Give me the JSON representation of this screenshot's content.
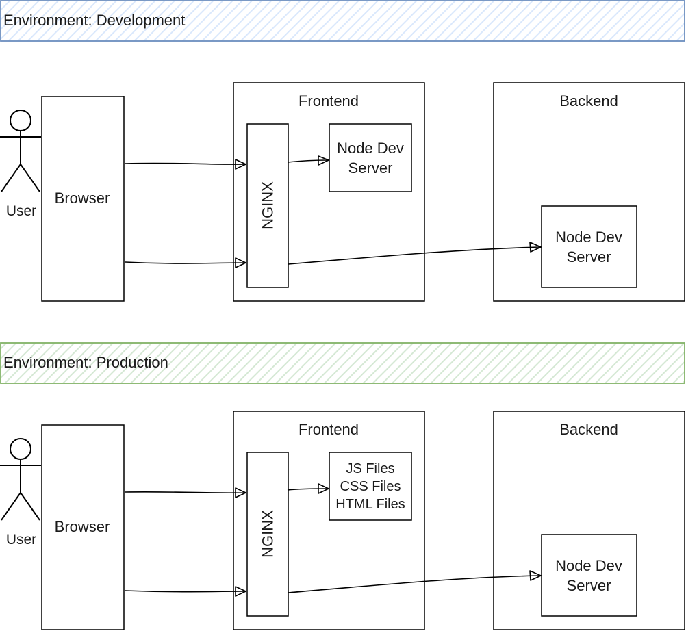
{
  "environments": [
    {
      "title": "Environment: Development",
      "color": "#6c8ebf",
      "hatch": "#dae8fc",
      "user_label": "User",
      "browser_label": "Browser",
      "frontend_label": "Frontend",
      "nginx_label": "NGINX",
      "frontend_target_lines": [
        "Node Dev",
        "Server"
      ],
      "backend_label": "Backend",
      "backend_server_lines": [
        "Node Dev",
        "Server"
      ]
    },
    {
      "title": "Environment: Production",
      "color": "#82b366",
      "hatch": "#d5e8d4",
      "user_label": "User",
      "browser_label": "Browser",
      "frontend_label": "Frontend",
      "nginx_label": "NGINX",
      "frontend_target_lines": [
        "JS Files",
        "CSS Files",
        "HTML Files"
      ],
      "backend_label": "Backend",
      "backend_server_lines": [
        "Node Dev",
        "Server"
      ]
    }
  ]
}
